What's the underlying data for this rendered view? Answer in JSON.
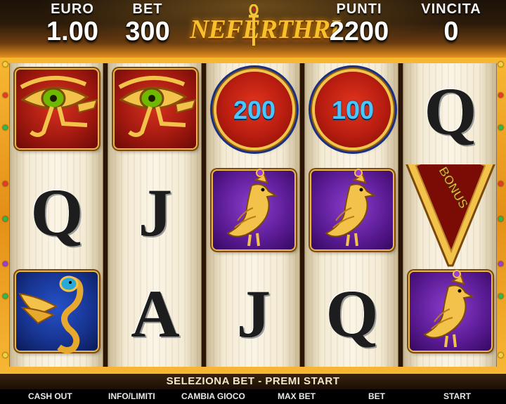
{
  "header": {
    "euro": {
      "label": "EURO",
      "value": "1.00"
    },
    "bet": {
      "label": "BET",
      "value": "300"
    },
    "points": {
      "label": "PUNTI",
      "value": "2200"
    },
    "win": {
      "label": "VINCITA",
      "value": "0"
    },
    "logo_text": "NEFERTHRI"
  },
  "reels": [
    [
      "eye-of-horus",
      "letter-Q",
      "winged-cobra"
    ],
    [
      "eye-of-horus",
      "letter-J",
      "letter-A"
    ],
    [
      "coin-200",
      "golden-falcon",
      "letter-J"
    ],
    [
      "coin-100",
      "golden-falcon",
      "letter-Q"
    ],
    [
      "letter-Q",
      "bonus",
      "golden-falcon"
    ]
  ],
  "symbols": {
    "letter_q": "Q",
    "letter_j": "J",
    "letter_a": "A",
    "coin_200": "200",
    "coin_100": "100",
    "bonus": "BONUS"
  },
  "status_message": "SELEZIONA BET - PREMI START",
  "buttons": {
    "cash_out": "CASH OUT",
    "info": "INFO/LIMITI",
    "change_game": "CAMBIA GIOCO",
    "max_bet": "MAX BET",
    "bet": "BET",
    "start": "START"
  },
  "colors": {
    "frame_gold": "#f0a628",
    "coin_value_blue": "#48c6ff",
    "tile_red": "#b81d10",
    "tile_purple": "#5a1b94",
    "tile_blue": "#17338f"
  }
}
